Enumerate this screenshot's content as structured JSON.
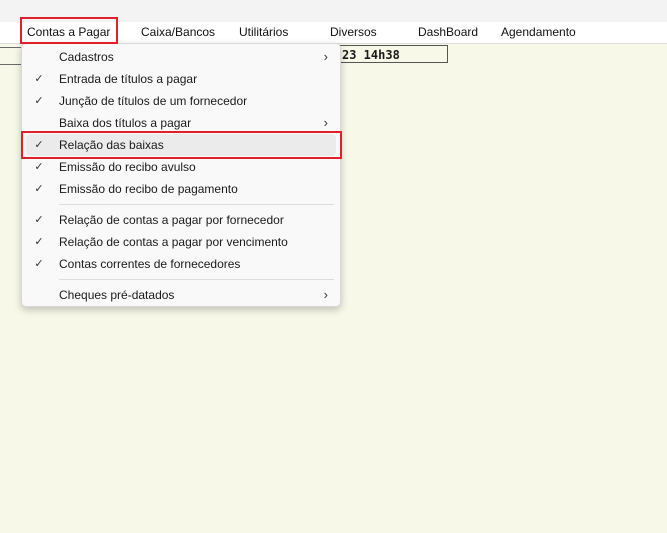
{
  "menubar": {
    "items": [
      {
        "label": "Contas a Pagar"
      },
      {
        "label": "Caixa/Bancos"
      },
      {
        "label": "Utilitários"
      },
      {
        "label": "Diversos"
      },
      {
        "label": "DashBoard"
      },
      {
        "label": "Agendamento"
      }
    ]
  },
  "background": {
    "datetime_partial": "23 14h38"
  },
  "dropdown": {
    "items": [
      {
        "label": "Cadastros",
        "check": "",
        "chevron": "›"
      },
      {
        "label": "Entrada de títulos a pagar",
        "check": "✓",
        "chevron": ""
      },
      {
        "label": "Junção de títulos de um fornecedor",
        "check": "✓",
        "chevron": ""
      },
      {
        "label": "Baixa dos títulos a pagar",
        "check": "",
        "chevron": "›"
      },
      {
        "label": "Relação das baixas",
        "check": "✓",
        "chevron": ""
      },
      {
        "label": "Emissão do recibo avulso",
        "check": "✓",
        "chevron": ""
      },
      {
        "label": "Emissão do recibo de pagamento",
        "check": "✓",
        "chevron": ""
      },
      {
        "label": "Relação de contas a pagar por fornecedor",
        "check": "✓",
        "chevron": ""
      },
      {
        "label": "Relação de contas a pagar por vencimento",
        "check": "✓",
        "chevron": ""
      },
      {
        "label": "Contas correntes de fornecedores",
        "check": "✓",
        "chevron": ""
      },
      {
        "label": "Cheques pré-datados",
        "check": "",
        "chevron": "›"
      }
    ]
  },
  "colors": {
    "highlight_border": "#e0202a",
    "app_background": "#f7f8e8",
    "menu_background": "#f9f9f9"
  }
}
